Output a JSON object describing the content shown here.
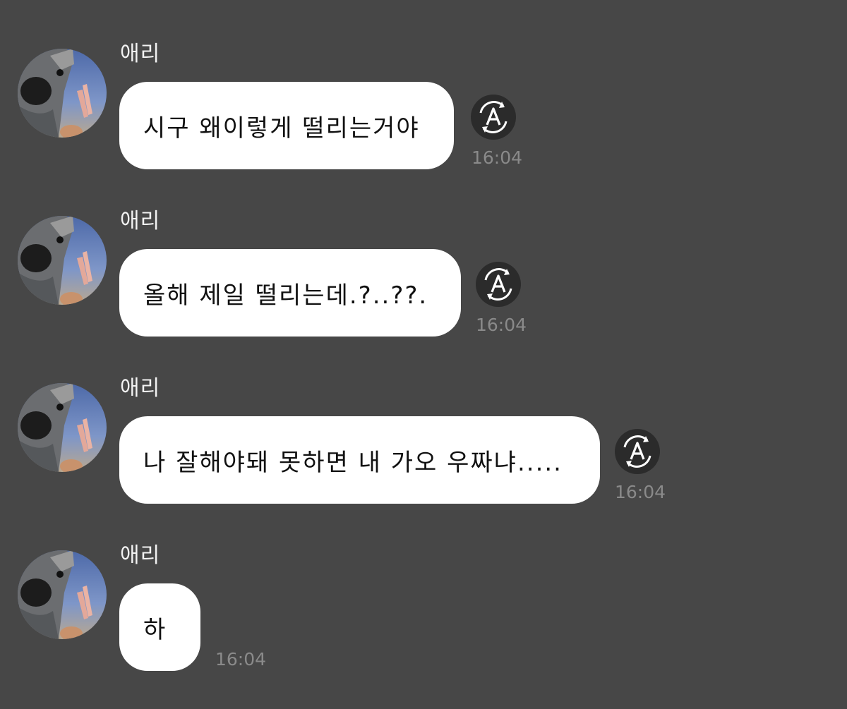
{
  "messages": [
    {
      "sender": "애리",
      "text": "시구 왜이렇게 떨리는거야",
      "time": "16:04",
      "translate_icon": "auto-translate-icon"
    },
    {
      "sender": "애리",
      "text": "올해 제일 떨리는데.?..??.",
      "time": "16:04",
      "translate_icon": "auto-translate-icon"
    },
    {
      "sender": "애리",
      "text": "나 잘해야돼 못하면 내 가오 우짜냐.....",
      "time": "16:04",
      "translate_icon": "auto-translate-icon"
    },
    {
      "sender": "애리",
      "text": "하",
      "time": "16:04"
    }
  ],
  "colors": {
    "background": "#474747",
    "bubble": "#ffffff",
    "sender_text": "#f2f2f2",
    "timestamp": "#8a8a8a",
    "translate_button": "#2b2b2b"
  }
}
